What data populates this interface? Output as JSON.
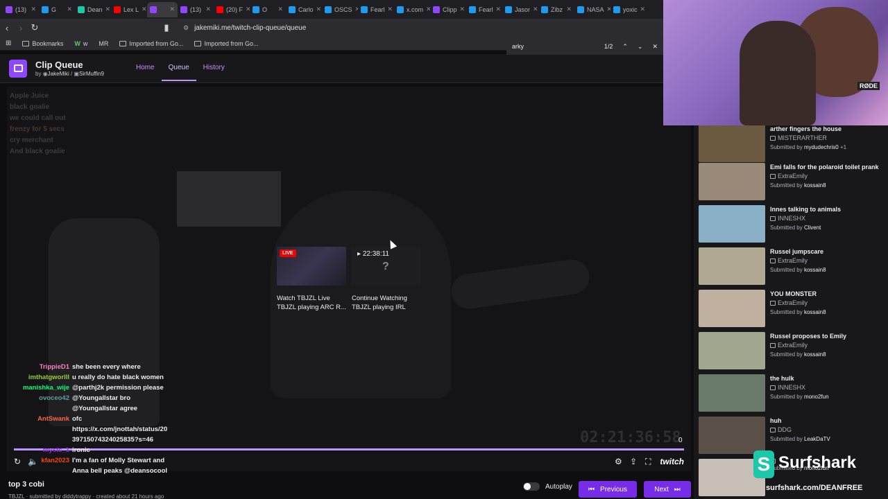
{
  "browser": {
    "tabs": [
      {
        "label": "(13) ",
        "color": "#9146ff"
      },
      {
        "label": "G",
        "color": "#1d9bf0"
      },
      {
        "label": "Dean",
        "color": "#1cc8aa"
      },
      {
        "label": "Lex L",
        "color": "#ff0000"
      },
      {
        "label": "",
        "color": "#9146ff",
        "active": true
      },
      {
        "label": "(13) ",
        "color": "#9146ff"
      },
      {
        "label": "(20) F",
        "color": "#ff0000"
      },
      {
        "label": "O",
        "color": "#1d9bf0"
      },
      {
        "label": "Carlo",
        "color": "#1d9bf0"
      },
      {
        "label": "OSCS",
        "color": "#1d9bf0"
      },
      {
        "label": "Fearl",
        "color": "#1d9bf0"
      },
      {
        "label": "x.com",
        "color": "#1d9bf0"
      },
      {
        "label": "Clipp",
        "color": "#9146ff"
      },
      {
        "label": "Fearl",
        "color": "#1d9bf0"
      },
      {
        "label": "Jasor",
        "color": "#1d9bf0"
      },
      {
        "label": "Zibz",
        "color": "#1d9bf0"
      },
      {
        "label": "NASA",
        "color": "#1d9bf0"
      },
      {
        "label": "yoxic",
        "color": "#1d9bf0"
      }
    ],
    "url": "jakemiki.me/twitch-clip-queue/queue",
    "bookmarks": [
      "Bookmarks",
      "w",
      "MR",
      "Imported from Go...",
      "Imported from Go..."
    ],
    "find": {
      "query": "arky",
      "count": "1/2"
    }
  },
  "app": {
    "title": "Clip Queue",
    "by": "by",
    "author1": "JakeMiki",
    "sep": "/",
    "author2": "SirMuffin9",
    "nav": [
      "Home",
      "Queue",
      "History"
    ]
  },
  "player": {
    "faded_chat": [
      {
        "u": "",
        "m": ""
      },
      {
        "u": "",
        "m": "Apple Juice"
      },
      {
        "u": "",
        "m": "black goalie"
      },
      {
        "u": "",
        "m": "we could call out"
      },
      {
        "u": "frenzy for 5 secs",
        "m": ""
      },
      {
        "u": "",
        "m": "cry merchant"
      },
      {
        "u": "",
        "m": "And black goalie"
      }
    ],
    "recs": [
      {
        "badge": "LIVE",
        "title": "Watch TBJZL Live",
        "sub": "TBJZL playing ARC R..."
      },
      {
        "badge": "22:38:11",
        "title": "Continue Watching",
        "sub": "TBJZL playing IRL"
      }
    ],
    "timestamp": "02:21:36:58",
    "counter": "0",
    "twitch": "twitch"
  },
  "chat": [
    {
      "user": "",
      "color": "#8a4a4a",
      "msg": "",
      "clip": true
    },
    {
      "user": "TrippieD1",
      "color": "#ff7fbf",
      "msg": "she been every where"
    },
    {
      "user": "imthatgworlll",
      "color": "#9acd32",
      "msg": "u really do hate black women"
    },
    {
      "user": "manishka_wije",
      "color": "#00ff7f",
      "msg": "@parthj2k permission please"
    },
    {
      "user": "ovoceo42",
      "color": "#5f9ea0",
      "msg": "@Youngallstar bro"
    },
    {
      "user": "",
      "color": "#b22222",
      "msg": "@Youngallstar agree"
    },
    {
      "user": "AntSwank",
      "color": "#ff6347",
      "msg": "ofc"
    },
    {
      "user": "",
      "color": "#ff4500",
      "msg": "https://x.com/jnottah/status/20"
    },
    {
      "user": "",
      "color": "#ff4500",
      "msg": "39715074324025835?s=46"
    },
    {
      "user": "mystc_1",
      "color": "#8a2be2",
      "msg": "ironic"
    },
    {
      "user": "kfan2023",
      "color": "#ff4500",
      "msg": "I'm a fan of Molly Stewart and"
    },
    {
      "user": "",
      "color": "#ff4500",
      "msg": "Anna bell peaks @deansocool"
    },
    {
      "user": "",
      "color": "#ff4500",
      "msg": "@Youngallstar She likes anime"
    },
    {
      "user": "",
      "color": "#ff4500",
      "msg": "too"
    }
  ],
  "bottom": {
    "top_label": "top 3 cobi",
    "info": "TBJZL  · submitted by diddytrappy · created about 21 hours ago",
    "autoplay": "Autoplay",
    "previous": "Previous",
    "next": "Next"
  },
  "queue": [
    {
      "title": "arther fingers the house",
      "channel": "MISTERARTHER",
      "submitted": "Submitted by",
      "by": "mydudechris0",
      "more": "+1",
      "color": "#6b5a40"
    },
    {
      "title": "Emi falls for the polaroid toilet prank",
      "channel": "ExtraEmily",
      "submitted": "Submitted by",
      "by": "kossain8",
      "more": "",
      "color": "#9a8a7a"
    },
    {
      "title": "Innes talking to animals",
      "channel": "INNESHX",
      "submitted": "Submitted by",
      "by": "Clivent",
      "more": "",
      "color": "#8ab0c8"
    },
    {
      "title": "Russel jumpscare",
      "channel": "ExtraEmily",
      "submitted": "Submitted by",
      "by": "kossain8",
      "more": "",
      "color": "#b0a890"
    },
    {
      "title": "YOU MONSTER",
      "channel": "ExtraEmily",
      "submitted": "Submitted by",
      "by": "kossain8",
      "more": "",
      "color": "#c0b0a0"
    },
    {
      "title": "Russel proposes to Emily",
      "channel": "ExtraEmily",
      "submitted": "Submitted by",
      "by": "kossain8",
      "more": "",
      "color": "#a0a890"
    },
    {
      "title": "the hulk",
      "channel": "INNESHX",
      "submitted": "Submitted by",
      "by": "mono2fun",
      "more": "",
      "color": "#6a7a6a"
    },
    {
      "title": "huh",
      "channel": "DDG",
      "submitted": "Submitted by",
      "by": "LeakDaTV",
      "more": "",
      "color": "#5a5048"
    },
    {
      "title": "",
      "channel": "",
      "submitted": "Submitted by",
      "by": "mono2fun",
      "more": "",
      "color": "#c8c0b8"
    }
  ],
  "webcam": {
    "mic_label": "RØDE"
  },
  "sponsor": {
    "name": "Surfshark",
    "url": "surfshark.com/DEANFREE"
  }
}
